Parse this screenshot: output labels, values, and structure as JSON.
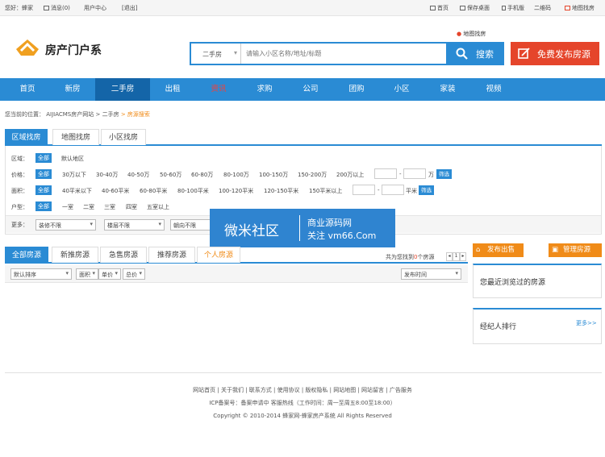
{
  "topbar": {
    "greeting": "您好：蜂家",
    "messages": "消息(0)",
    "user_center": "用户中心",
    "logout": "[退出]",
    "home": "首页",
    "save_desktop": "保存桌面",
    "mobile": "手机版",
    "qrcode": "二维码",
    "map_search": "地图找房"
  },
  "header": {
    "logo_text": "房产门户系",
    "map_link": "地图找房",
    "search_select": "二手房",
    "search_placeholder": "请输入小区名称/地址/标题",
    "search_button": "搜索",
    "publish_button": "免费发布房源"
  },
  "nav": {
    "items": [
      {
        "label": "首页"
      },
      {
        "label": "新房"
      },
      {
        "label": "二手房"
      },
      {
        "label": "出租"
      },
      {
        "label": "资讯"
      },
      {
        "label": "求购"
      },
      {
        "label": "公司"
      },
      {
        "label": "团购"
      },
      {
        "label": "小区"
      },
      {
        "label": "家装"
      },
      {
        "label": "视频"
      }
    ]
  },
  "breadcrumb": {
    "prefix": "您当前的位置：",
    "site": "AIJIACMS房产网站",
    "sep1": " > ",
    "section": "二手房",
    "sep2": " > ",
    "current": "房源搜索"
  },
  "search_tabs": [
    "区域找房",
    "地图找房",
    "小区找房"
  ],
  "filters": {
    "region_label": "区域：",
    "all": "全部",
    "region_default": "默认地区",
    "price_label": "价格：",
    "price_options": [
      "30万以下",
      "30-40万",
      "40-50万",
      "50-60万",
      "60-80万",
      "80-100万",
      "100-150万",
      "150-200万",
      "200万以上"
    ],
    "price_unit": "万",
    "filter_button": "筛选",
    "area_label": "面积：",
    "area_options": [
      "40平米以下",
      "40-60平米",
      "60-80平米",
      "80-100平米",
      "100-120平米",
      "120-150平米",
      "150平米以上"
    ],
    "area_unit": "平米",
    "layout_label": "户型：",
    "layout_options": [
      "一室",
      "二室",
      "三室",
      "四室",
      "五室以上"
    ],
    "more_label": "更多：",
    "more_selects": [
      "装修不限",
      "楼层不限",
      "朝向不限"
    ],
    "dash": "-"
  },
  "watermark": {
    "brand": "微米社区",
    "line1": "商业源码网",
    "line2": "关注 vm66.Com"
  },
  "listing_tabs": [
    "全部房源",
    "新推房源",
    "急售房源",
    "推荐房源",
    "个人房源"
  ],
  "listing_info": {
    "found_prefix": "共为您找到",
    "count": "0",
    "found_suffix": "个房源",
    "page": "1"
  },
  "sort_bar": {
    "sort_default": "默认排序",
    "area": "面积",
    "unit_price": "单价",
    "total_price": "总价",
    "publish_time": "发布时间"
  },
  "sidebar": {
    "publish_sale": "发布出售",
    "manage_listings": "管理房源",
    "recent_title": "您最近浏览过的房源",
    "agent_rank_title": "经纪人排行",
    "more": "更多>>"
  },
  "footer": {
    "links": [
      "网站首页",
      "关于我们",
      "联系方式",
      "使用协议",
      "版权隐私",
      "网站地图",
      "网站留言",
      "广告服务"
    ],
    "icp": "ICP备案号：备案申请中 客服热线（工作时间：周一至周五8:00至18:00）",
    "copyright": "Copyright © 2010-2014 蜂家网-蜂家房产系统 All Rights Reserved"
  },
  "colors": {
    "primary": "#2a8bd4",
    "nav_active": "#1465a8",
    "accent_red": "#e5452b",
    "accent_orange": "#f08b18"
  }
}
